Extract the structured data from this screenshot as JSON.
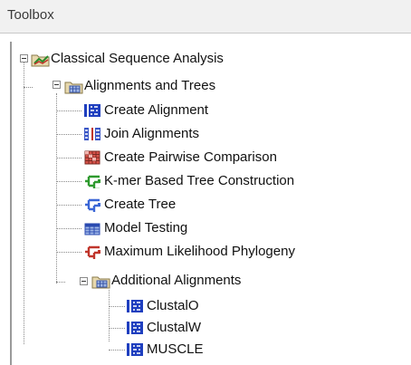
{
  "panel": {
    "title": "Toolbox"
  },
  "tree": {
    "root": {
      "label": "Classical Sequence Analysis",
      "icon": "folder-chart-icon",
      "children": [
        {
          "label": "Alignments and Trees",
          "icon": "folder-table-icon",
          "children": [
            {
              "label": "Create Alignment",
              "icon": "alignment-icon"
            },
            {
              "label": "Join Alignments",
              "icon": "join-alignments-icon"
            },
            {
              "label": "Create Pairwise Comparison",
              "icon": "pairwise-grid-icon"
            },
            {
              "label": "K-mer Based Tree Construction",
              "icon": "tree-green-icon"
            },
            {
              "label": "Create Tree",
              "icon": "tree-blue-icon"
            },
            {
              "label": "Model Testing",
              "icon": "model-testing-icon"
            },
            {
              "label": "Maximum Likelihood Phylogeny",
              "icon": "tree-red-icon"
            },
            {
              "label": "Additional Alignments",
              "icon": "folder-table-icon",
              "children": [
                {
                  "label": "ClustalO",
                  "icon": "alignment-icon"
                },
                {
                  "label": "ClustalW",
                  "icon": "alignment-icon"
                },
                {
                  "label": "MUSCLE",
                  "icon": "alignment-icon"
                }
              ]
            }
          ]
        }
      ]
    }
  },
  "colors": {
    "alignment_blue": "#1f3fbf",
    "tree_green": "#2e9a2e",
    "tree_blue": "#3a66d6",
    "tree_red": "#c0352b",
    "grid_red": "#b23a30",
    "folder_tan": "#d9c08a"
  }
}
